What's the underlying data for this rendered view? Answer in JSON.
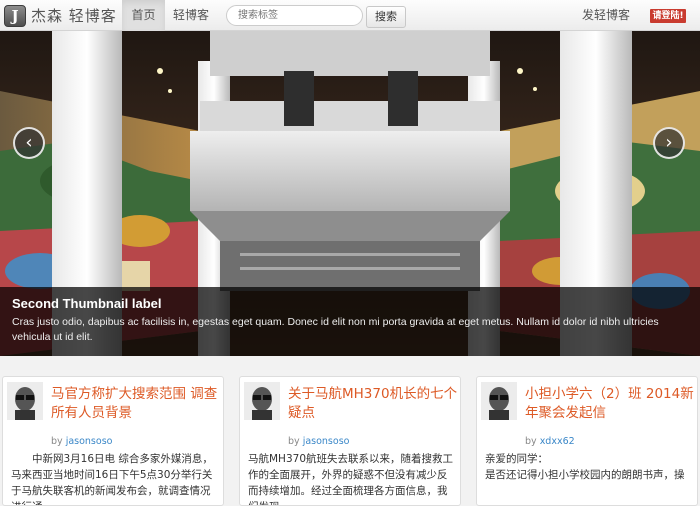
{
  "navbar": {
    "brand_letter": "J",
    "brand_name": "杰森 轻博客",
    "home": "首页",
    "blog": "轻博客",
    "search_placeholder": "搜索标签",
    "search_button": "搜索",
    "post": "发轻博客",
    "login": "请登陆!"
  },
  "carousel": {
    "prev": "‹",
    "next": "›",
    "title": "Second Thumbnail label",
    "text": "Cras justo odio, dapibus ac facilisis in, egestas eget quam. Donec id elit non mi porta gravida at eget metus. Nullam id dolor id nibh ultricies vehicula ut id elit."
  },
  "cards": [
    {
      "title": "马官方称扩大搜索范围 调查所有人员背景",
      "by": "by",
      "author": "jasonsoso",
      "body": "中新网3月16日电 综合多家外媒消息，马来西亚当地时间16日下午5点30分举行关于马航失联客机的新闻发布会，就调查情况进行通"
    },
    {
      "title": "关于马航MH370机长的七个疑点",
      "by": "by",
      "author": "jasonsoso",
      "body": "马航MH370航班失去联系以来，随着搜救工作的全面展开，外界的疑惑不但没有减少反而持续增加。经过全面梳理各方面信息，我们发现"
    },
    {
      "title": "小担小学六（2）班 2014新年聚会发起信",
      "by": "by",
      "author": "xdxx62",
      "body": "亲爱的同学：\n是否还记得小担小学校园内的朗朗书声，操"
    }
  ],
  "colors": {
    "accent_title": "#dd5a26",
    "link": "#3a87c8",
    "login_bg": "#c93b2f"
  }
}
